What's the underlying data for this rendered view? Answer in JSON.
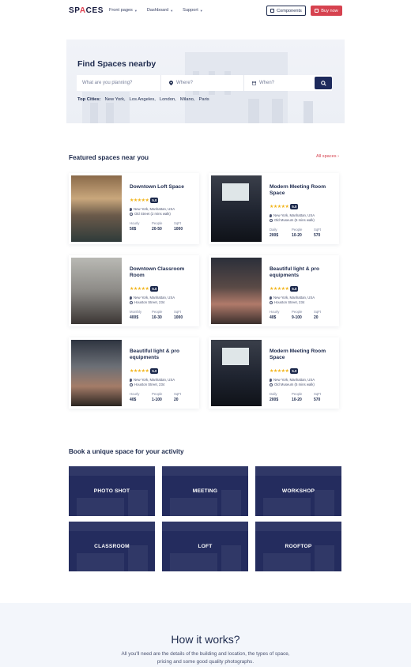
{
  "nav": {
    "logo_main": "SP",
    "logo_accent": "A",
    "logo_rest": "CES",
    "links": [
      {
        "label": "Front pages"
      },
      {
        "label": "Dashboard"
      },
      {
        "label": "Support"
      }
    ],
    "components_label": "Components",
    "buy_label": "Buy now"
  },
  "hero": {
    "title": "Find Spaces nearby",
    "search_placeholder": "What are you planning?",
    "where_placeholder": "Where?",
    "when_placeholder": "When?",
    "top_cities_label": "Top Cities:",
    "cities": [
      "New York,",
      "Los Angeles,",
      "London,",
      "Milano,",
      "Paris"
    ]
  },
  "featured": {
    "title": "Featured spaces near you",
    "all_link": "All spaces",
    "stats_labels": {
      "people": "People",
      "sqft": "SqFt"
    },
    "cards": [
      {
        "title": "Downtown Loft Space",
        "stars": "★★★★★",
        "rating": "5.0",
        "address": "New York, Manhattan, USA",
        "near": "Old Street (2 mins walk)",
        "price_label": "Hourly",
        "price": "50$",
        "people": "20-50",
        "sqft": "1000"
      },
      {
        "title": "Modern Meeting Room Space",
        "stars": "★★★★★",
        "rating": "5.0",
        "address": "New York, Manhattan, USA",
        "near": "Old Museum (5 mins walk)",
        "price_label": "Daily",
        "price": "200$",
        "people": "10-20",
        "sqft": "570"
      },
      {
        "title": "Downtown Classroom Room",
        "stars": "★★★★★",
        "rating": "5.0",
        "address": "New York, Manhattan, USA",
        "near": "Houston Street, 234",
        "price_label": "Monthly",
        "price": "400$",
        "people": "10-30",
        "sqft": "1000"
      },
      {
        "title": "Beautiful light & pro equipments",
        "stars": "★★★★★",
        "rating": "5.0",
        "address": "New York, Manhattan, USA",
        "near": "Houston Street, 234",
        "price_label": "Hourly",
        "price": "40$",
        "people": "9-100",
        "sqft": "20"
      },
      {
        "title": "Beautiful light & pro equipments",
        "stars": "★★★★★",
        "rating": "5.0",
        "address": "New York, Manhattan, USA",
        "near": "Houston Street, 234",
        "price_label": "Hourly",
        "price": "40$",
        "people": "1-100",
        "sqft": "20"
      },
      {
        "title": "Modern Meeting Room Space",
        "stars": "★★★★★",
        "rating": "5.0",
        "address": "New York, Manhattan, USA",
        "near": "Old Museum (5 mins walk)",
        "price_label": "Daily",
        "price": "200$",
        "people": "10-20",
        "sqft": "570"
      }
    ]
  },
  "activities": {
    "title": "Book a unique space for your activity",
    "tiles": [
      "PHOTO SHOT",
      "MEETING",
      "WORKSHOP",
      "CLASSROOM",
      "LOFT",
      "ROOFTOP"
    ]
  },
  "how": {
    "title": "How it works?",
    "text": "All you'll need are the details of the building and location, the types of space, pricing and some good quality photographs."
  },
  "colors": {
    "navy": "#1d2a4d",
    "accent_red": "#d6424f",
    "star_yellow": "#f2b51d",
    "tile_navy": "#242c5e"
  }
}
